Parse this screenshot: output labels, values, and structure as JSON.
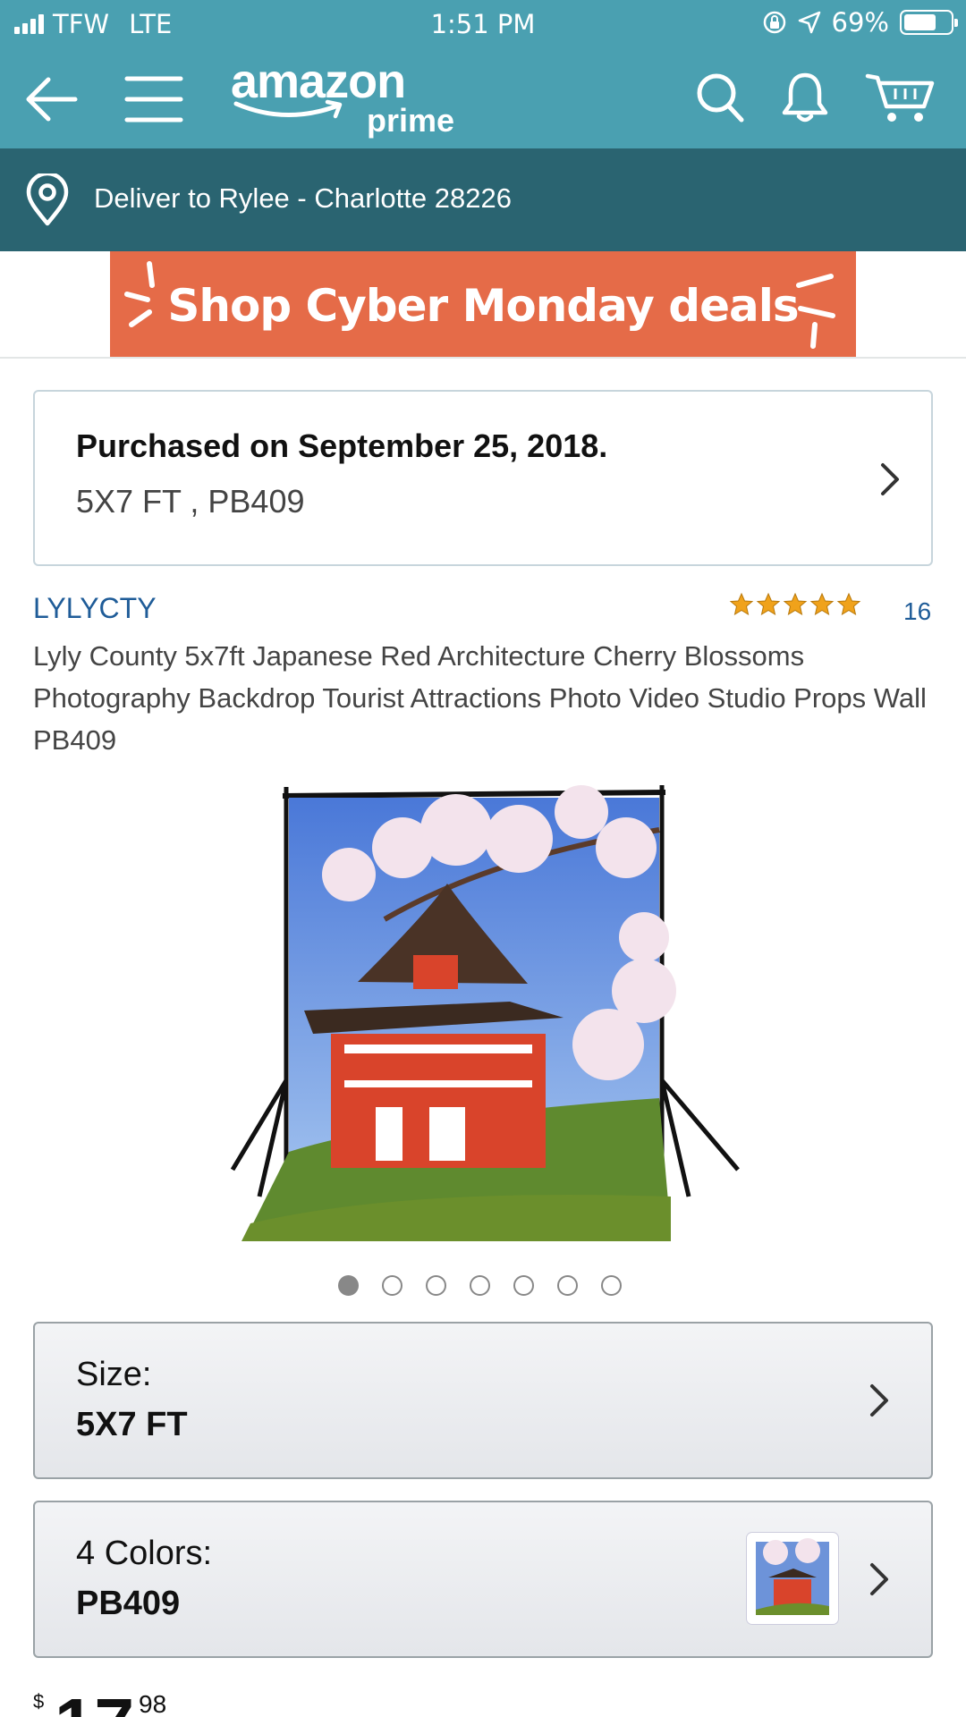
{
  "status_bar": {
    "carrier": "TFW",
    "network": "LTE",
    "time": "1:51 PM",
    "battery": "69%",
    "battery_level": 0.69
  },
  "header": {
    "logo_word": "amazon",
    "logo_sub": "prime",
    "icons": [
      "back-arrow-icon",
      "menu-icon",
      "search-icon",
      "bell-icon",
      "cart-icon"
    ]
  },
  "delivery": {
    "text": "Deliver to Rylee - Charlotte 28226",
    "icon": "location-pin-icon"
  },
  "banner": {
    "text": "Shop Cyber Monday deals",
    "color": "#e56b48"
  },
  "purchase": {
    "title": "Purchased on September 25, 2018.",
    "details": "5X7 FT , PB409"
  },
  "product": {
    "brand": "LYLYCTY",
    "rating_stars": 5,
    "review_count": "16",
    "title": "Lyly County 5x7ft Japanese Red Architecture Cherry Blossoms Photography Backdrop Tourist Attractions Photo Video Studio Props Wall PB409",
    "image_count": 7,
    "active_image": 1
  },
  "options": {
    "size_label": "Size:",
    "size_value": "5X7 FT",
    "color_label": "4 Colors:",
    "color_value": "PB409"
  },
  "price": {
    "currency": "$",
    "whole": "17",
    "fraction": "98"
  },
  "colors": {
    "header": "#4aa0b1",
    "delivery_bar": "#2a6471",
    "link": "#1f5c98",
    "star": "#f0a21b"
  }
}
